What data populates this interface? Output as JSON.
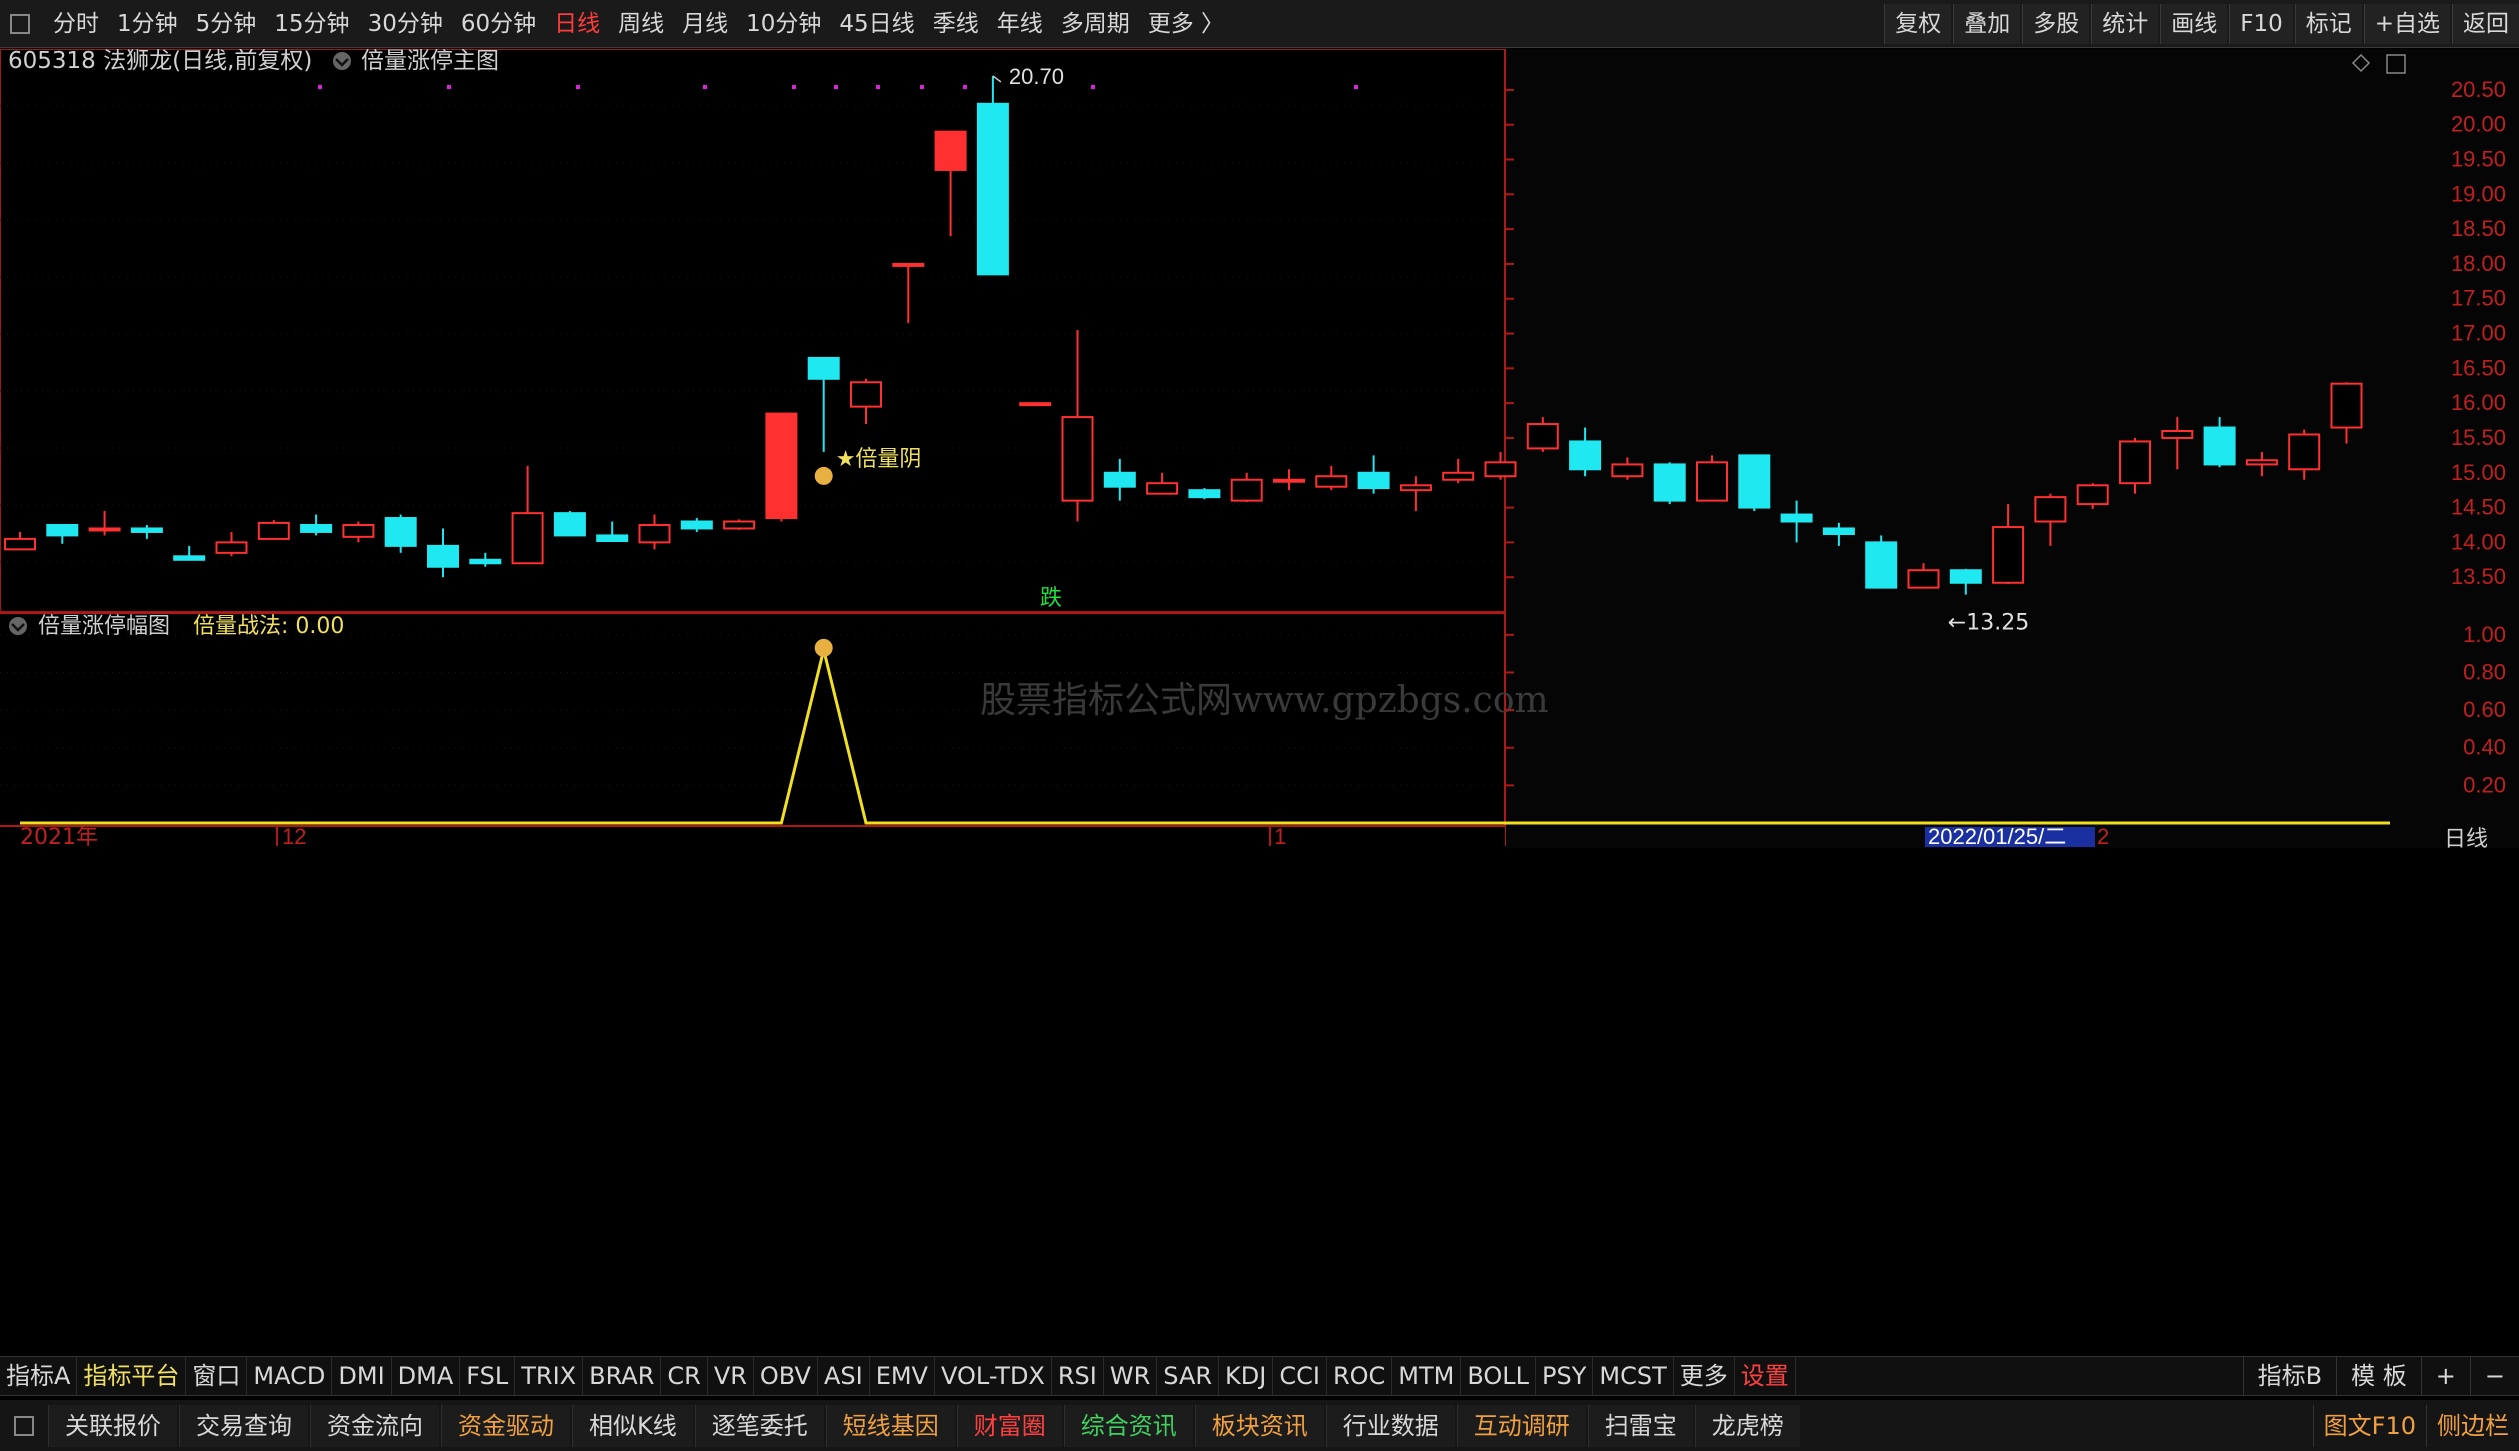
{
  "top_tabs": [
    "分时",
    "1分钟",
    "5分钟",
    "15分钟",
    "30分钟",
    "60分钟",
    "日线",
    "周线",
    "月线",
    "10分钟",
    "45日线",
    "季线",
    "年线",
    "多周期",
    "更多 〉"
  ],
  "top_active": 6,
  "top_right": [
    "复权",
    "叠加",
    "多股",
    "统计",
    "画线",
    "F10",
    "标记",
    "+自选",
    "返回"
  ],
  "title": {
    "code": "605318",
    "name": "法狮龙",
    "mode": "(日线,前复权)",
    "indicator": "倍量涨停主图"
  },
  "price_axis": [
    "20.50",
    "20.00",
    "19.50",
    "19.00",
    "18.50",
    "18.00",
    "17.50",
    "17.00",
    "16.50",
    "16.00",
    "15.50",
    "15.00",
    "14.50",
    "14.00",
    "13.50"
  ],
  "lower_axis": [
    "1.00",
    "0.80",
    "0.60",
    "0.40",
    "0.20"
  ],
  "annotations": {
    "high_label": "20.70",
    "low_label": "13.25",
    "signal_label": "★倍量阴",
    "fall_label": "跌",
    "watermark": "股票指标公式网www.gpzbgs.com"
  },
  "lower_panel": {
    "name": "倍量涨停幅图",
    "series_label": "倍量战法: 0.00"
  },
  "time_axis": {
    "year_label": "2021年",
    "month_12": "12",
    "month_1": "1",
    "cursor_date": "2022/01/25/二",
    "tail": "2",
    "period": "日线"
  },
  "indicator_tabs": [
    "指标A",
    "指标平台",
    "窗口",
    "MACD",
    "DMI",
    "DMA",
    "FSL",
    "TRIX",
    "BRAR",
    "CR",
    "VR",
    "OBV",
    "ASI",
    "EMV",
    "VOL-TDX",
    "RSI",
    "WR",
    "SAR",
    "KDJ",
    "CCI",
    "ROC",
    "MTM",
    "BOLL",
    "PSY",
    "MCST",
    "更多",
    "设置"
  ],
  "indicator_right": [
    "指标B",
    "模 板",
    "+",
    "−"
  ],
  "bottom_tabs": [
    "关联报价",
    "交易查询",
    "资金流向",
    "资金驱动",
    "相似K线",
    "逐笔委托",
    "短线基因",
    "财富圈",
    "综合资讯",
    "板块资讯",
    "行业数据",
    "互动调研",
    "扫雷宝",
    "龙虎榜"
  ],
  "bottom_right": [
    "图文F10",
    "侧边栏"
  ],
  "chart_data": {
    "type": "candlestick",
    "ylim": [
      13.0,
      20.8
    ],
    "candles": [
      {
        "o": 13.9,
        "c": 14.05,
        "h": 14.15,
        "l": 13.9
      },
      {
        "o": 14.25,
        "c": 14.1,
        "h": 14.25,
        "l": 13.98
      },
      {
        "o": 14.2,
        "c": 14.2,
        "h": 14.45,
        "l": 14.1
      },
      {
        "o": 14.2,
        "c": 14.15,
        "h": 14.25,
        "l": 14.05
      },
      {
        "o": 13.8,
        "c": 13.75,
        "h": 13.95,
        "l": 13.75
      },
      {
        "o": 13.85,
        "c": 14.0,
        "h": 14.15,
        "l": 13.8
      },
      {
        "o": 14.05,
        "c": 14.28,
        "h": 14.32,
        "l": 14.05
      },
      {
        "o": 14.25,
        "c": 14.15,
        "h": 14.4,
        "l": 14.1
      },
      {
        "o": 14.08,
        "c": 14.25,
        "h": 14.3,
        "l": 14.0
      },
      {
        "o": 14.35,
        "c": 13.95,
        "h": 14.4,
        "l": 13.85
      },
      {
        "o": 13.95,
        "c": 13.65,
        "h": 14.2,
        "l": 13.5
      },
      {
        "o": 13.75,
        "c": 13.7,
        "h": 13.85,
        "l": 13.65
      },
      {
        "o": 13.7,
        "c": 14.42,
        "h": 15.1,
        "l": 13.7
      },
      {
        "o": 14.42,
        "c": 14.1,
        "h": 14.45,
        "l": 14.1
      },
      {
        "o": 14.1,
        "c": 14.02,
        "h": 14.3,
        "l": 14.02
      },
      {
        "o": 14.0,
        "c": 14.25,
        "h": 14.4,
        "l": 13.9
      },
      {
        "o": 14.3,
        "c": 14.2,
        "h": 14.35,
        "l": 14.15
      },
      {
        "o": 14.2,
        "c": 14.3,
        "h": 14.33,
        "l": 14.18
      },
      {
        "o": 14.35,
        "c": 15.85,
        "h": 15.85,
        "l": 14.3
      },
      {
        "o": 16.65,
        "c": 16.35,
        "h": 16.65,
        "l": 15.3
      },
      {
        "o": 15.95,
        "c": 16.3,
        "h": 16.35,
        "l": 15.7
      },
      {
        "o": 18.0,
        "c": 18.0,
        "h": 18.0,
        "l": 17.15
      },
      {
        "o": 19.35,
        "c": 19.9,
        "h": 19.9,
        "l": 18.4
      },
      {
        "o": 20.3,
        "c": 17.85,
        "h": 20.7,
        "l": 17.85
      },
      {
        "o": 16.0,
        "c": 16.0,
        "h": 16.0,
        "l": 16.0
      },
      {
        "o": 14.6,
        "c": 15.8,
        "h": 17.05,
        "l": 14.3
      },
      {
        "o": 15.0,
        "c": 14.8,
        "h": 15.2,
        "l": 14.6
      },
      {
        "o": 14.7,
        "c": 14.85,
        "h": 15.0,
        "l": 14.7
      },
      {
        "o": 14.75,
        "c": 14.65,
        "h": 14.78,
        "l": 14.62
      },
      {
        "o": 14.6,
        "c": 14.9,
        "h": 15.0,
        "l": 14.58
      },
      {
        "o": 14.9,
        "c": 14.9,
        "h": 15.05,
        "l": 14.75
      },
      {
        "o": 14.8,
        "c": 14.95,
        "h": 15.1,
        "l": 14.75
      },
      {
        "o": 15.0,
        "c": 14.78,
        "h": 15.25,
        "l": 14.7
      },
      {
        "o": 14.75,
        "c": 14.82,
        "h": 14.95,
        "l": 14.45
      },
      {
        "o": 14.9,
        "c": 15.0,
        "h": 15.2,
        "l": 14.85
      },
      {
        "o": 14.95,
        "c": 15.15,
        "h": 15.3,
        "l": 14.9
      },
      {
        "o": 15.35,
        "c": 15.7,
        "h": 15.8,
        "l": 15.3
      },
      {
        "o": 15.45,
        "c": 15.05,
        "h": 15.65,
        "l": 14.95
      },
      {
        "o": 14.95,
        "c": 15.12,
        "h": 15.22,
        "l": 14.9
      },
      {
        "o": 15.12,
        "c": 14.6,
        "h": 15.15,
        "l": 14.55
      },
      {
        "o": 14.6,
        "c": 15.15,
        "h": 15.25,
        "l": 14.6
      },
      {
        "o": 15.25,
        "c": 14.5,
        "h": 15.25,
        "l": 14.45
      },
      {
        "o": 14.4,
        "c": 14.3,
        "h": 14.6,
        "l": 14.0
      },
      {
        "o": 14.2,
        "c": 14.12,
        "h": 14.28,
        "l": 13.95
      },
      {
        "o": 14.0,
        "c": 13.35,
        "h": 14.1,
        "l": 13.35
      },
      {
        "o": 13.35,
        "c": 13.6,
        "h": 13.7,
        "l": 13.35
      },
      {
        "o": 13.6,
        "c": 13.42,
        "h": 13.62,
        "l": 13.25
      },
      {
        "o": 13.42,
        "c": 14.22,
        "h": 14.55,
        "l": 13.4
      },
      {
        "o": 14.3,
        "c": 14.65,
        "h": 14.7,
        "l": 13.95
      },
      {
        "o": 14.55,
        "c": 14.82,
        "h": 14.85,
        "l": 14.48
      },
      {
        "o": 14.85,
        "c": 15.45,
        "h": 15.5,
        "l": 14.7
      },
      {
        "o": 15.5,
        "c": 15.6,
        "h": 15.8,
        "l": 15.05
      },
      {
        "o": 15.65,
        "c": 15.12,
        "h": 15.8,
        "l": 15.08
      },
      {
        "o": 15.12,
        "c": 15.18,
        "h": 15.3,
        "l": 14.95
      },
      {
        "o": 15.05,
        "c": 15.55,
        "h": 15.62,
        "l": 14.9
      },
      {
        "o": 15.65,
        "c": 16.28,
        "h": 16.3,
        "l": 15.42
      }
    ],
    "lower_series": {
      "name": "倍量战法",
      "values_peak_index": 19,
      "peak": 0.92,
      "ylim": [
        0,
        1.1
      ]
    }
  }
}
